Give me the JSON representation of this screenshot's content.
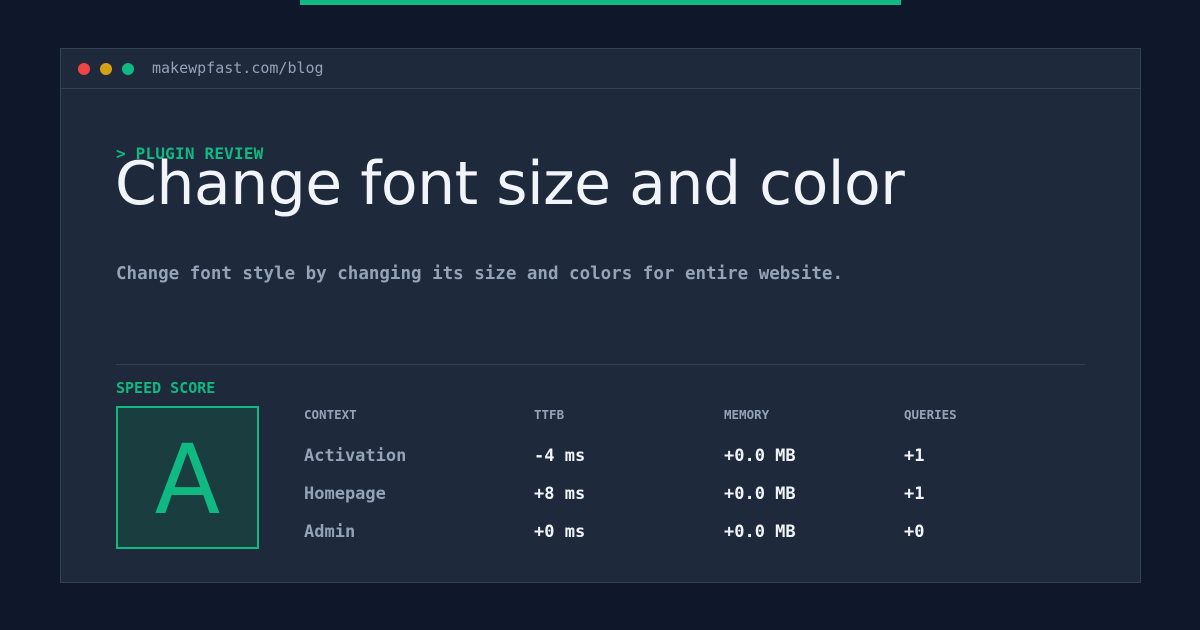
{
  "top_accent_color": "#10b981",
  "window": {
    "traffic_lights": [
      "red",
      "yellow",
      "green"
    ],
    "url": "makewpfast.com/blog"
  },
  "article": {
    "kicker": "> PLUGIN REVIEW",
    "title": "Change font size and color",
    "subtitle": "Change font style by changing its size and colors for entire website."
  },
  "speed": {
    "label": "SPEED SCORE",
    "grade": "A"
  },
  "metrics": {
    "headers": [
      "CONTEXT",
      "TTFB",
      "MEMORY",
      "QUERIES"
    ],
    "rows": [
      {
        "context": "Activation",
        "ttfb": "-4 ms",
        "memory": "+0.0 MB",
        "queries": "+1"
      },
      {
        "context": "Homepage",
        "ttfb": "+8 ms",
        "memory": "+0.0 MB",
        "queries": "+1"
      },
      {
        "context": "Admin",
        "ttfb": "+0 ms",
        "memory": "+0.0 MB",
        "queries": "+0"
      }
    ]
  },
  "colors": {
    "background": "#0f172a",
    "card": "#1e293b",
    "accent": "#10b981",
    "muted_text": "#94a3b8",
    "bright_text": "#f1f5f9"
  }
}
